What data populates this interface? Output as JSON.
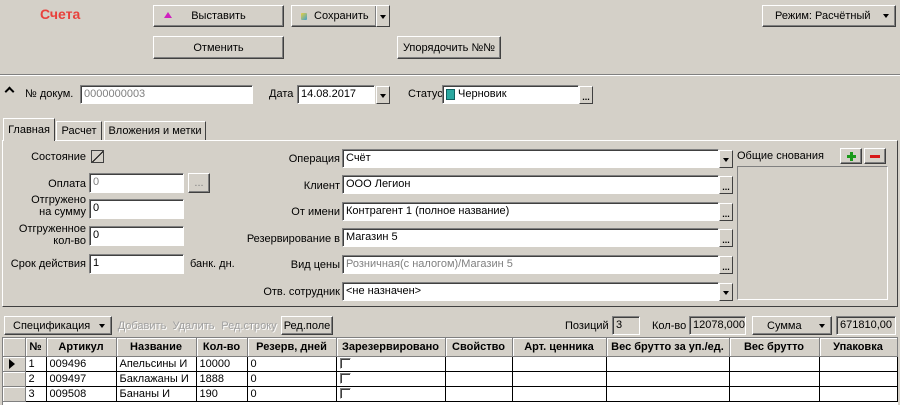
{
  "window": {
    "title": "Счета"
  },
  "toolbar": {
    "paste_label": "Выставить",
    "save_label": "Сохранить",
    "cancel_label": "Отменить",
    "order_label": "Упорядочить №№",
    "mode_label": "Режим: Расчётный"
  },
  "header": {
    "doc_no_label": "№ докум.",
    "doc_no_value": "0000000003",
    "date_label": "Дата",
    "date_value": "14.08.2017",
    "status_label": "Статус",
    "status_value": "Черновик"
  },
  "tabs": [
    {
      "label": "Главная"
    },
    {
      "label": "Расчет"
    },
    {
      "label": "Вложения и метки"
    }
  ],
  "main": {
    "state_label": "Состояние",
    "payment_label": "Оплата",
    "payment_value": "0",
    "shipped_sum_label_1": "Отгружено",
    "shipped_sum_label_2": "на сумму",
    "shipped_sum_value": "0",
    "shipped_qty_label_1": "Отгруженное",
    "shipped_qty_label_2": "кол-во",
    "shipped_qty_value": "0",
    "term_label": "Срок действия",
    "term_value": "1",
    "term_unit": "банк. дн.",
    "operation_label": "Операция",
    "operation_value": "Счёт",
    "client_label": "Клиент",
    "client_value": "ООО Легион",
    "on_behalf_label": "От имени",
    "on_behalf_value": "Контрагент 1 (полное название)",
    "reserve_label": "Резервирование в",
    "reserve_value": "Магазин 5",
    "price_type_label": "Вид цены",
    "price_type_value": "Розничная(с налогом)/Магазин 5",
    "employee_label": "Отв. сотрудник",
    "employee_value": "<не назначен>",
    "bases_label": "Общие снования"
  },
  "spec": {
    "spec_label": "Спецификация",
    "add_label": "Добавить",
    "delete_label": "Удалить",
    "edit_row_label": "Ред.строку",
    "edit_field_label": "Ред.поле",
    "positions_label": "Позиций",
    "positions_value": "3",
    "qty_label": "Кол-во",
    "qty_value": "12078,000",
    "sum_select": "Сумма",
    "sum_value": "671810,00"
  },
  "table": {
    "columns": [
      "№",
      "Артикул",
      "Название",
      "Кол-во",
      "Резерв, дней",
      "Зарезервировано",
      "Свойство",
      "Арт. ценника",
      "Вес брутто за уп./ед.",
      "Вес брутто",
      "Упаковка"
    ],
    "rows": [
      {
        "no": "1",
        "article": "009496",
        "name": "Апельсины И",
        "qty": "10000",
        "reserve": "0"
      },
      {
        "no": "2",
        "article": "009497",
        "name": "Баклажаны И",
        "qty": "1888",
        "reserve": "0"
      },
      {
        "no": "3",
        "article": "009508",
        "name": "Бананы И",
        "qty": "190",
        "reserve": "0"
      }
    ]
  },
  "colors": {
    "title": "#e8413c",
    "background": "#d4d0c8",
    "status_icon": "#2aa8a0",
    "add_green": "#1a9a1a",
    "remove_red": "#d81818"
  },
  "icons": [
    "paste-icon",
    "save-icon",
    "chevron-up-icon",
    "status-icon",
    "add-icon",
    "remove-icon",
    "row-pointer-icon"
  ]
}
